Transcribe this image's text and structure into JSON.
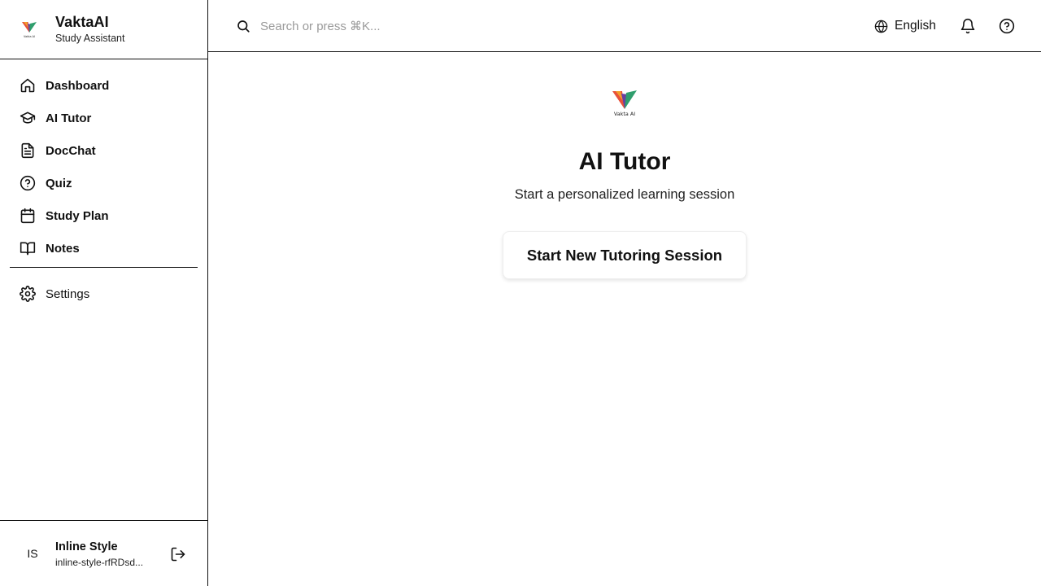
{
  "brand": {
    "name": "VaktaAI",
    "subtitle": "Study Assistant",
    "logo_text": "Vakta AI",
    "colors": [
      "#e8513a",
      "#f4a02b",
      "#2f9e6d",
      "#6b3fa0"
    ]
  },
  "sidebar": {
    "items": [
      {
        "label": "Dashboard",
        "icon": "home-icon"
      },
      {
        "label": "AI Tutor",
        "icon": "graduation-cap-icon"
      },
      {
        "label": "DocChat",
        "icon": "document-icon"
      },
      {
        "label": "Quiz",
        "icon": "question-circle-icon"
      },
      {
        "label": "Study Plan",
        "icon": "calendar-icon"
      },
      {
        "label": "Notes",
        "icon": "book-open-icon"
      }
    ],
    "settings": {
      "label": "Settings",
      "icon": "gear-icon"
    }
  },
  "user": {
    "initials": "IS",
    "name": "Inline Style",
    "email": "inline-style-rfRDsd..."
  },
  "topbar": {
    "search_placeholder": "Search or press ⌘K...",
    "search_value": "",
    "language": "English"
  },
  "main": {
    "title": "AI Tutor",
    "subtitle": "Start a personalized learning session",
    "start_button": "Start New Tutoring Session"
  }
}
